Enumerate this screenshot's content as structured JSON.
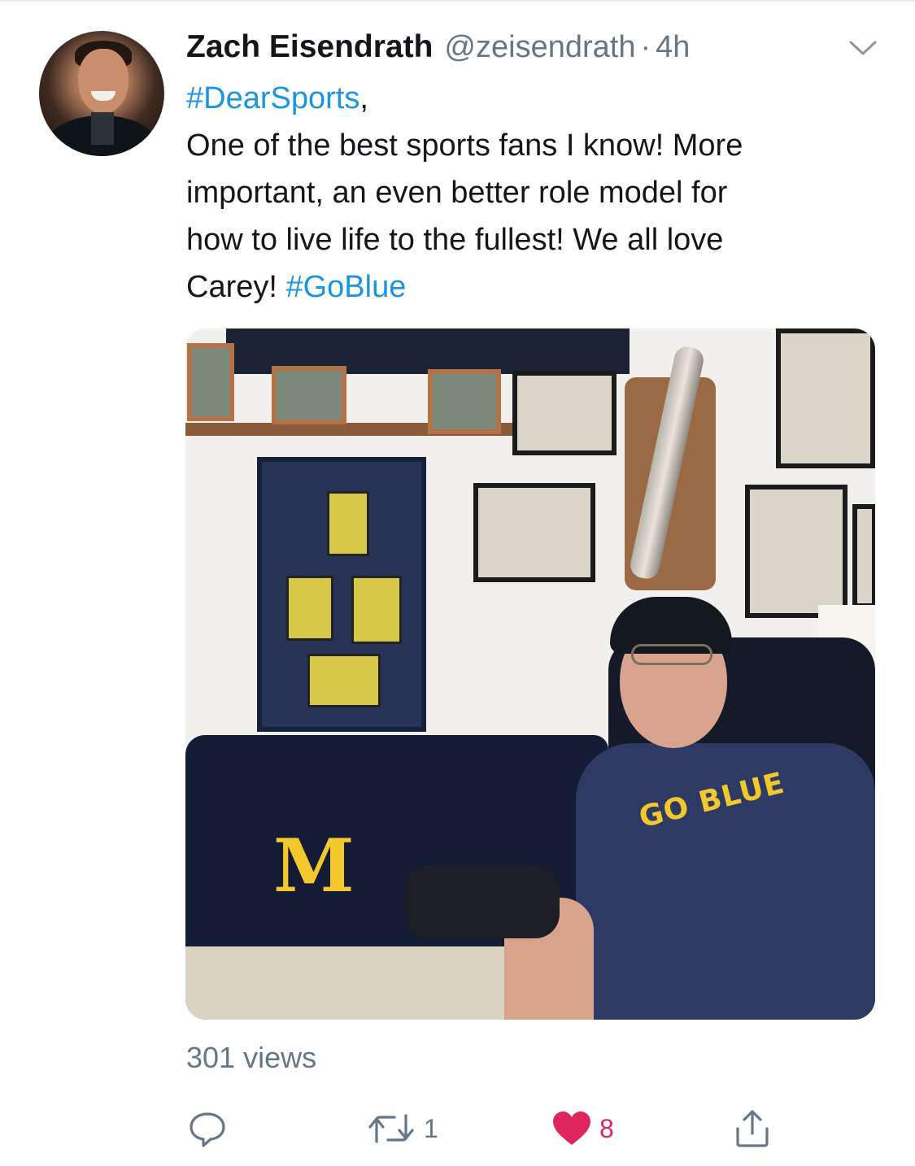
{
  "tweet": {
    "author_name": "Zach Eisendrath",
    "author_handle": "@zeisendrath",
    "separator": "·",
    "time_ago": "4h",
    "text_lines": [
      [
        {
          "text": "#DearSports",
          "hashtag": true
        },
        {
          "text": ",",
          "hashtag": false
        }
      ],
      [
        {
          "text": "One of the best sports fans I know! More",
          "hashtag": false
        }
      ],
      [
        {
          "text": "important, an even better role model for",
          "hashtag": false
        }
      ],
      [
        {
          "text": "how to live life to the fullest!  We all love",
          "hashtag": false
        }
      ],
      [
        {
          "text": "Carey! ",
          "hashtag": false
        },
        {
          "text": "#GoBlue",
          "hashtag": true
        }
      ]
    ],
    "media": {
      "shirt_text": "GO BLUE",
      "blanket_text": "M"
    },
    "views": "301 views",
    "stats": {
      "reply": "",
      "retweets": "1",
      "likes": "8"
    }
  },
  "icons": {
    "menu": "chevron-down-icon",
    "reply": "reply-icon",
    "retweet": "retweet-icon",
    "like": "heart-icon",
    "share": "share-icon"
  },
  "colors": {
    "hashtag": "#1b95e0",
    "secondary_text": "#657786",
    "like_active": "#e0245e"
  }
}
